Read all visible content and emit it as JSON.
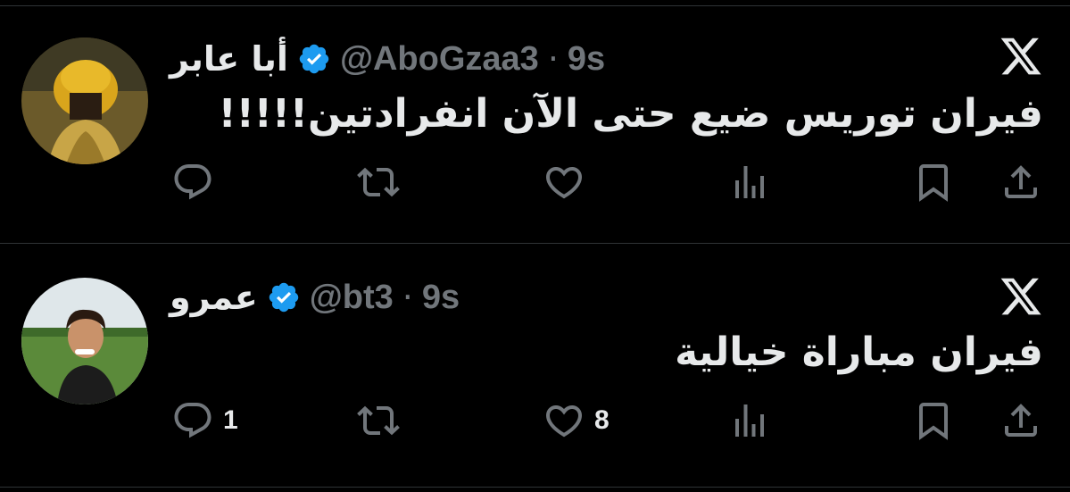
{
  "tweets": [
    {
      "display_name": "أبا عابر",
      "handle": "@AboGzaa3",
      "separator": "·",
      "time": "9s",
      "text": "فيران توريس ضيع حتى الآن انفرادتين!!!!!",
      "reply_count": "",
      "retweet_count": "",
      "like_count": "",
      "views_count": ""
    },
    {
      "display_name": "عمرو",
      "handle": "@bt3",
      "separator": "·",
      "time": "9s",
      "text": "فيران مباراة خيالية",
      "reply_count": "1",
      "retweet_count": "",
      "like_count": "8",
      "views_count": ""
    }
  ],
  "colors": {
    "background": "#000000",
    "text_primary": "#e7e9ea",
    "text_secondary": "#71767b",
    "verified_badge": "#1d9bf0",
    "divider": "#2f3336"
  },
  "icons": [
    "x-logo-icon",
    "verified-badge-icon",
    "reply-icon",
    "retweet-icon",
    "like-icon",
    "views-icon",
    "bookmark-icon",
    "share-icon"
  ]
}
